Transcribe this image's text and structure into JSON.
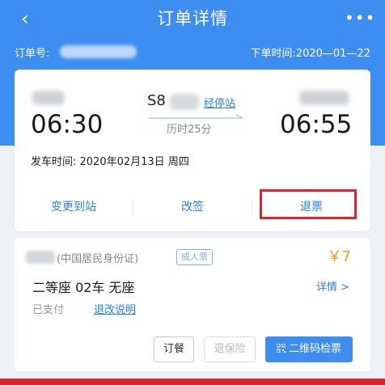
{
  "header": {
    "title": "订单详情",
    "back_icon": "back-icon",
    "more_icon": "more-icon"
  },
  "order": {
    "number_label": "订单号:",
    "order_time": "下单时间:2020—01—22"
  },
  "trip": {
    "depart_time": "06:30",
    "arrive_time": "06:55",
    "train_number": "S8",
    "via_stations_link": "经停站",
    "duration": "历时25分",
    "departure_date_line": "发车时间: 2020年02月13日 周四"
  },
  "actions": {
    "change_destination": "变更到站",
    "reschedule": "改签",
    "refund": "退票"
  },
  "passenger": {
    "id_type": "(中国居民身份证)",
    "ticket_type": "成人票",
    "price": "￥7",
    "seat_info": "二等座 02车 无座",
    "detail_link": "详情 >",
    "pay_status": "已支付",
    "refund_rules_link": "退改说明"
  },
  "buttons": {
    "order_meal": "订餐",
    "cancel_insurance": "退保险",
    "qr_checkin": "二维码检票"
  },
  "colors": {
    "brand_blue": "#3d8ef0",
    "highlight_red": "#d9262c",
    "price_orange": "#f39c12"
  }
}
